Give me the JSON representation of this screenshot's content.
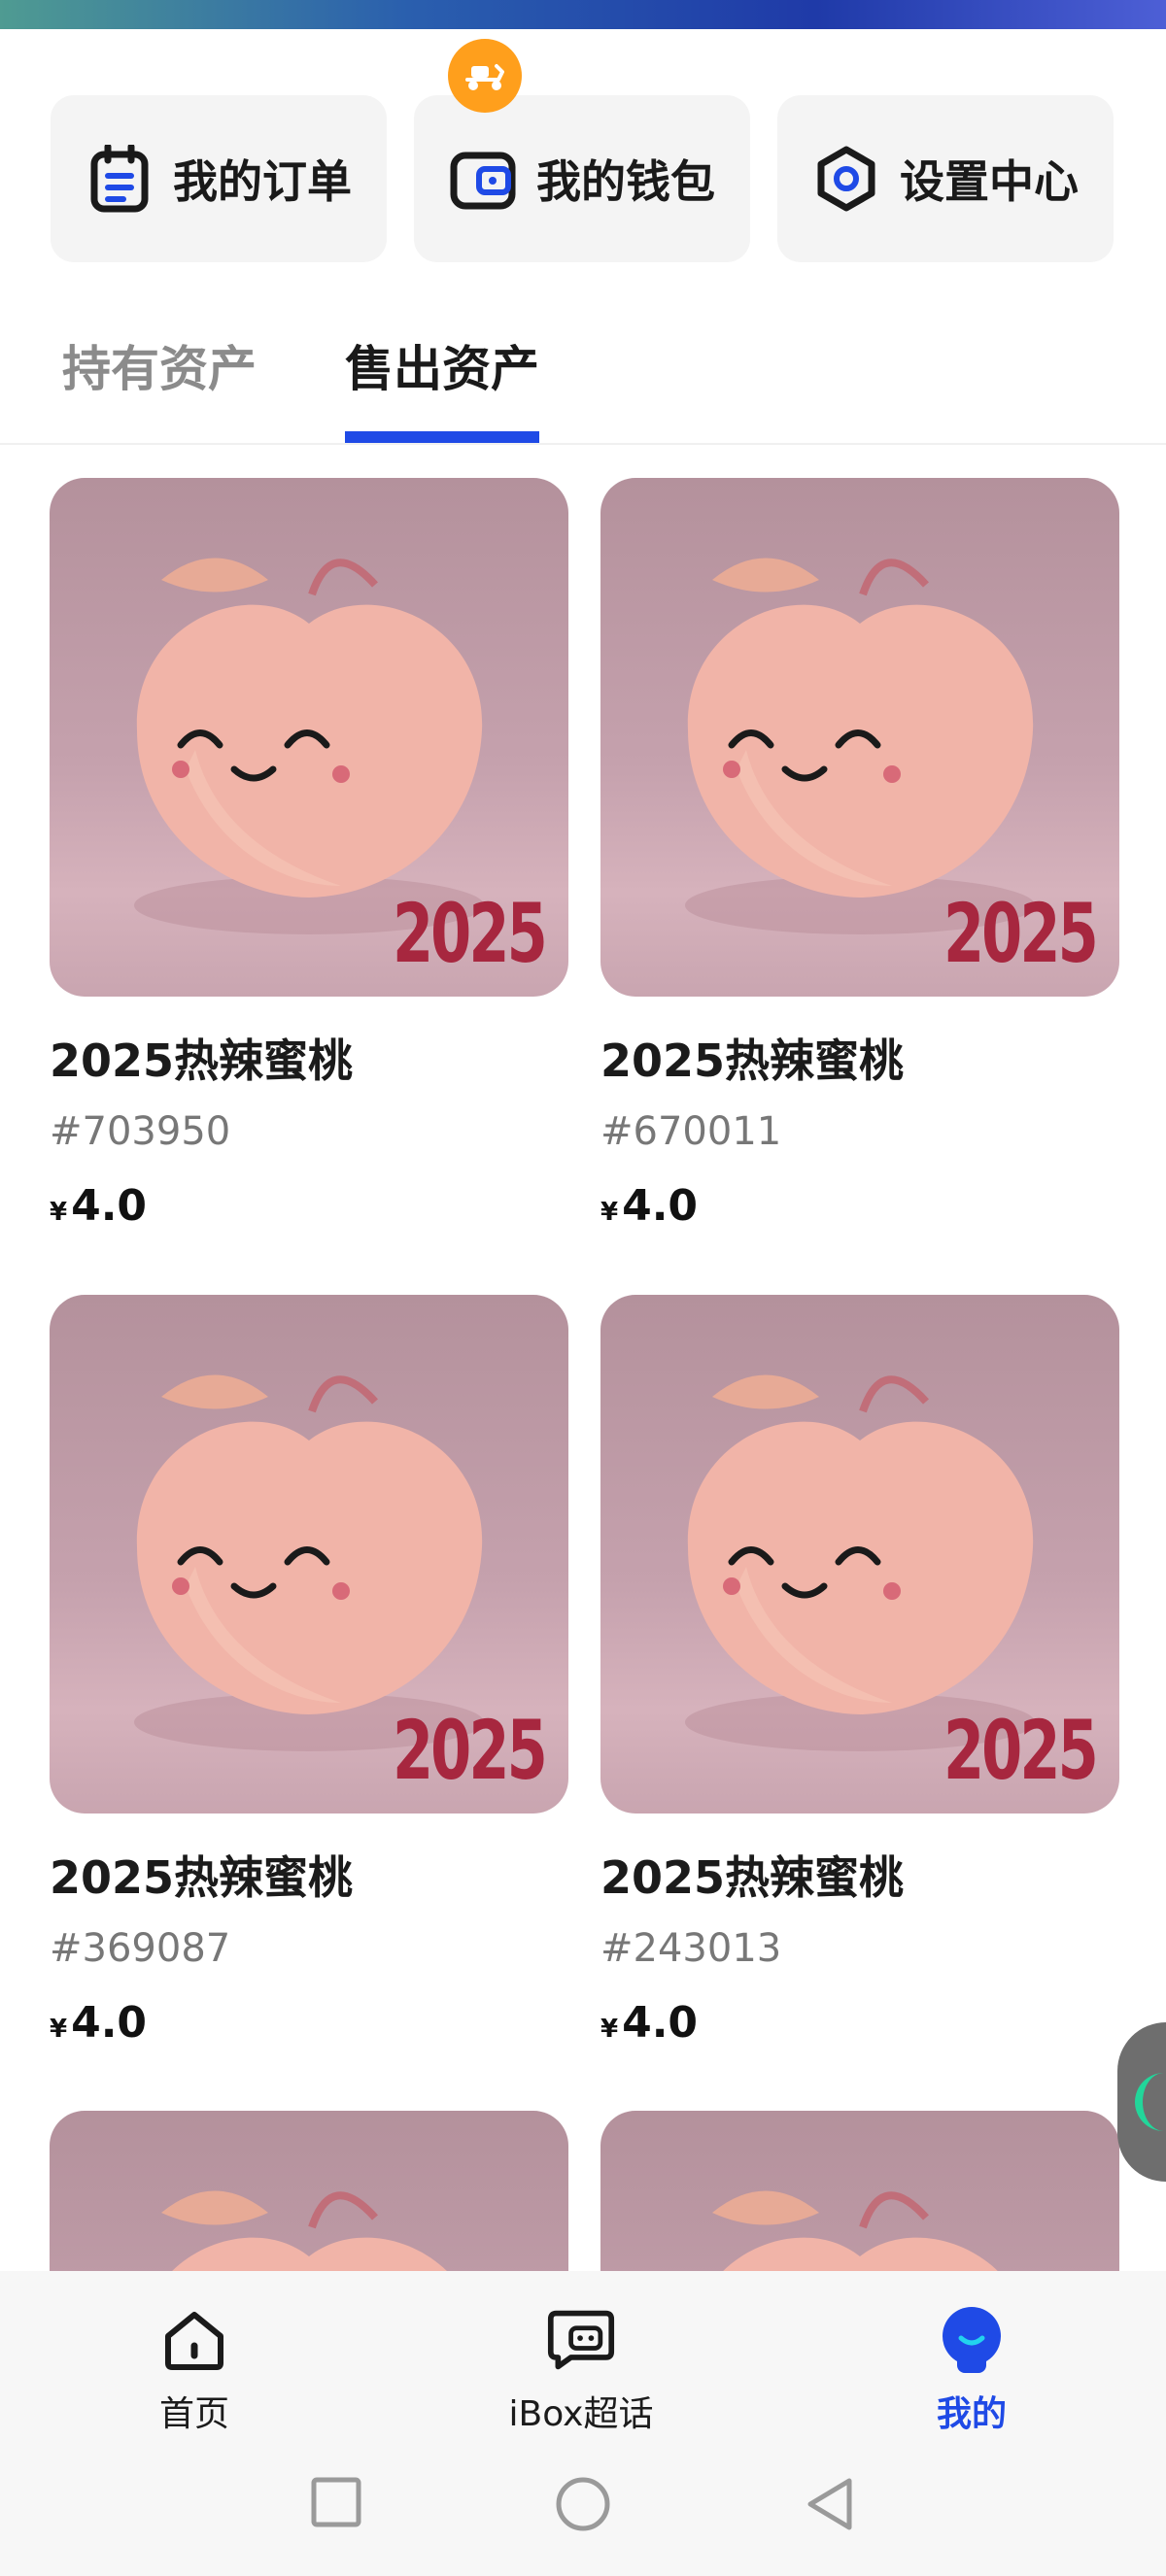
{
  "quick_actions": [
    {
      "label": "我的订单",
      "icon": "order-icon"
    },
    {
      "label": "我的钱包",
      "icon": "wallet-icon"
    },
    {
      "label": "设置中心",
      "icon": "settings-icon"
    }
  ],
  "badge_icon": "scooter-icon",
  "tabs": [
    {
      "label": "持有资产",
      "active": false
    },
    {
      "label": "售出资产",
      "active": true
    }
  ],
  "items": [
    {
      "name": "2025热辣蜜桃",
      "serial": "#703950",
      "currency": "¥",
      "price": "4.0",
      "image_text": "2025"
    },
    {
      "name": "2025热辣蜜桃",
      "serial": "#670011",
      "currency": "¥",
      "price": "4.0",
      "image_text": "2025"
    },
    {
      "name": "2025热辣蜜桃",
      "serial": "#369087",
      "currency": "¥",
      "price": "4.0",
      "image_text": "2025"
    },
    {
      "name": "2025热辣蜜桃",
      "serial": "#243013",
      "currency": "¥",
      "price": "4.0",
      "image_text": "2025"
    }
  ],
  "bottom_nav": [
    {
      "label": "首页",
      "icon": "home-icon",
      "active": false
    },
    {
      "label": "iBox超话",
      "icon": "chat-icon",
      "active": false
    },
    {
      "label": "我的",
      "icon": "profile-icon",
      "active": true
    }
  ],
  "colors": {
    "accent": "#1f4ae6",
    "badge": "#ff9f1c",
    "year_text": "#a7273f"
  }
}
